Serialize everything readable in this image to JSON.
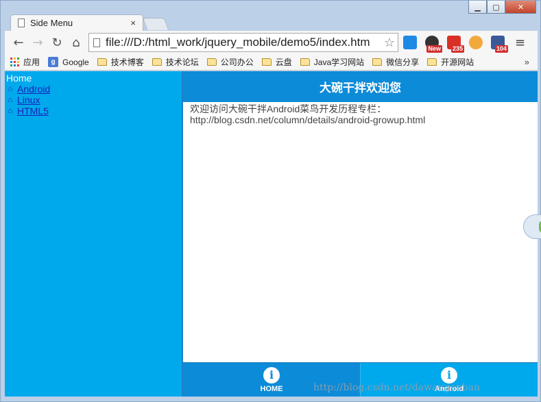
{
  "window": {
    "tab_title": "Side Menu",
    "tab_close": "×",
    "minimize": "▁",
    "maximize": "▢",
    "close": "✕"
  },
  "toolbar": {
    "back": "←",
    "forward": "→",
    "reload": "↻",
    "home": "⌂",
    "url": "file:///D:/html_work/jquery_mobile/demo5/index.htm",
    "star": "☆",
    "menu": "≡",
    "extensions": [
      {
        "name": "calculator-ext",
        "color": "#1e88e5",
        "badge": ""
      },
      {
        "name": "speedometer-ext",
        "color": "#333333",
        "badge": "New"
      },
      {
        "name": "weibo-ext",
        "color": "#d93025",
        "badge": "235"
      },
      {
        "name": "weather-ext",
        "color": "#f2a93b",
        "badge": ""
      },
      {
        "name": "facebook-ext",
        "color": "#3b5998",
        "badge": "104"
      }
    ]
  },
  "bookmarks": {
    "apps": "应用",
    "items": [
      "Google",
      "技术博客",
      "技术论坛",
      "公司办公",
      "云盘",
      "Java学习网站",
      "微信分享",
      "开源网站"
    ],
    "more": "»"
  },
  "side_menu": {
    "home": "Home",
    "links": [
      "Android",
      "Linux",
      "HTML5"
    ]
  },
  "page": {
    "header": "大碗干拌欢迎您",
    "content_line1": "欢迎访问大碗干拌Android菜鸟开发历程专栏：",
    "content_line2": "http://blog.csdn.net/column/details/android-growup.html"
  },
  "footer": {
    "buttons": [
      "HOME",
      "Android"
    ]
  },
  "watermark": "http://blog.csdn.net/dawanganban"
}
